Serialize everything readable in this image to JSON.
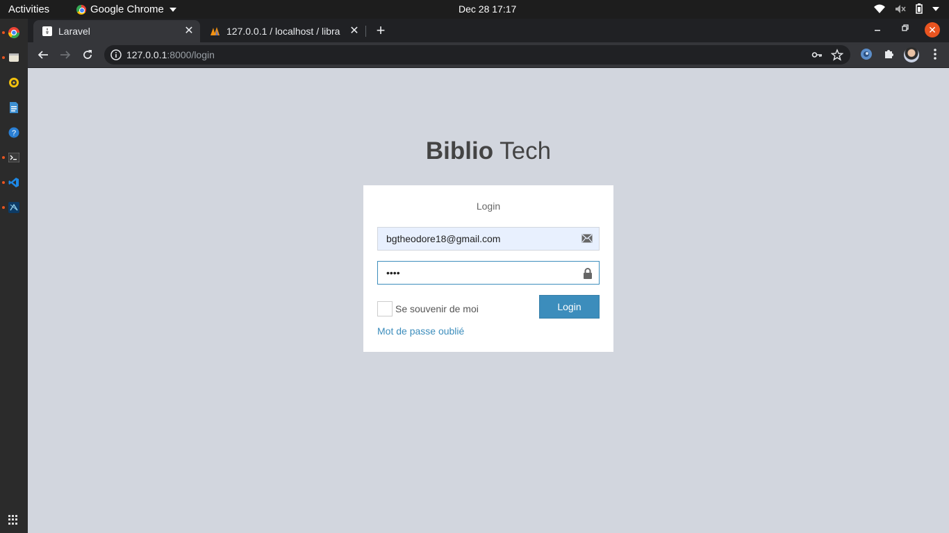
{
  "system": {
    "activities_label": "Activities",
    "app_name": "Google Chrome",
    "clock": "Dec 28  17:17"
  },
  "dock": {
    "items": [
      "chrome-icon",
      "files-icon",
      "rhythmbox-icon",
      "writer-icon",
      "help-icon",
      "terminal-icon",
      "vscode-icon",
      "studio-icon"
    ]
  },
  "browser": {
    "tabs": [
      {
        "title": "Laravel",
        "active": true
      },
      {
        "title": "127.0.0.1 / localhost / libra",
        "active": false
      }
    ],
    "address": {
      "host": "127.0.0.1",
      "path": ":8000/login"
    }
  },
  "page": {
    "brand_bold": "Biblio",
    "brand_light": " Tech",
    "login_box_msg": "Login",
    "email_value": "bgtheodore18@gmail.com",
    "password_value": "••••",
    "remember_label": "Se souvenir de moi",
    "submit_label": "Login",
    "forgot_label": "Mot de passe oublié"
  },
  "colors": {
    "page_bg": "#d2d6de",
    "primary": "#3c8dbc",
    "autofill_bg": "#e8f0fe"
  }
}
